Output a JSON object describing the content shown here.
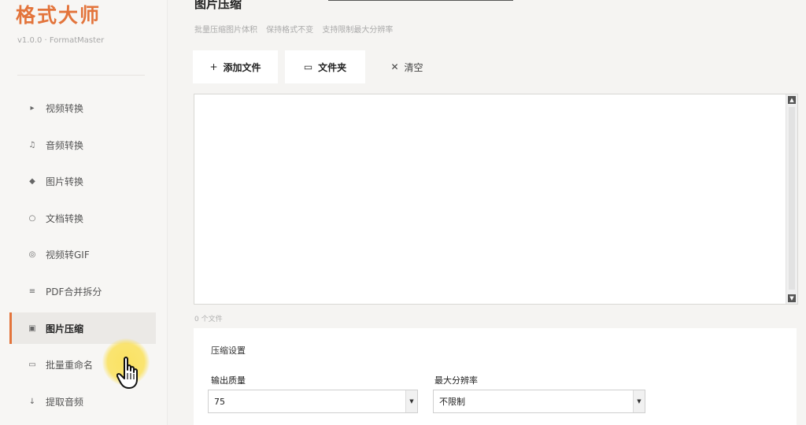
{
  "brand": {
    "title": "格式大师",
    "version": "v1.0.0 · FormatMaster"
  },
  "sidebar": {
    "items": [
      {
        "icon": "play-icon",
        "glyph": "▸",
        "label": "视频转换",
        "active": false
      },
      {
        "icon": "music-note-icon",
        "glyph": "♫",
        "label": "音频转换",
        "active": false
      },
      {
        "icon": "diamond-icon",
        "glyph": "◆",
        "label": "图片转换",
        "active": false
      },
      {
        "icon": "circle-icon",
        "glyph": "○",
        "label": "文档转换",
        "active": false
      },
      {
        "icon": "record-icon",
        "glyph": "◎",
        "label": "视频转GIF",
        "active": false
      },
      {
        "icon": "list-icon",
        "glyph": "≡",
        "label": "PDF合并拆分",
        "active": false
      },
      {
        "icon": "compress-icon",
        "glyph": "▣",
        "label": "图片压缩",
        "active": true
      },
      {
        "icon": "rename-icon",
        "glyph": "▭",
        "label": "批量重命名",
        "active": false
      },
      {
        "icon": "download-arrow-icon",
        "glyph": "↓",
        "label": "提取音频",
        "active": false
      }
    ]
  },
  "main": {
    "title": "图片压缩",
    "subtitle": "批量压缩图片体积 保持格式不变 支持限制最大分辨率",
    "toolbar": {
      "add_icon": "+",
      "add_label": "添加文件",
      "folder_icon": "▭",
      "folder_label": "文件夹",
      "clear_icon": "✕",
      "clear_label": "清空"
    },
    "file_count": "0 个文件",
    "settings": {
      "title": "压缩设置",
      "quality_label": "输出质量",
      "quality_value": "75",
      "resolution_label": "最大分辨率",
      "resolution_value": "不限制"
    }
  },
  "colors": {
    "accent": "#e3743b",
    "active_bg": "#ebe9e6",
    "cursor_highlight": "#fae15a"
  }
}
